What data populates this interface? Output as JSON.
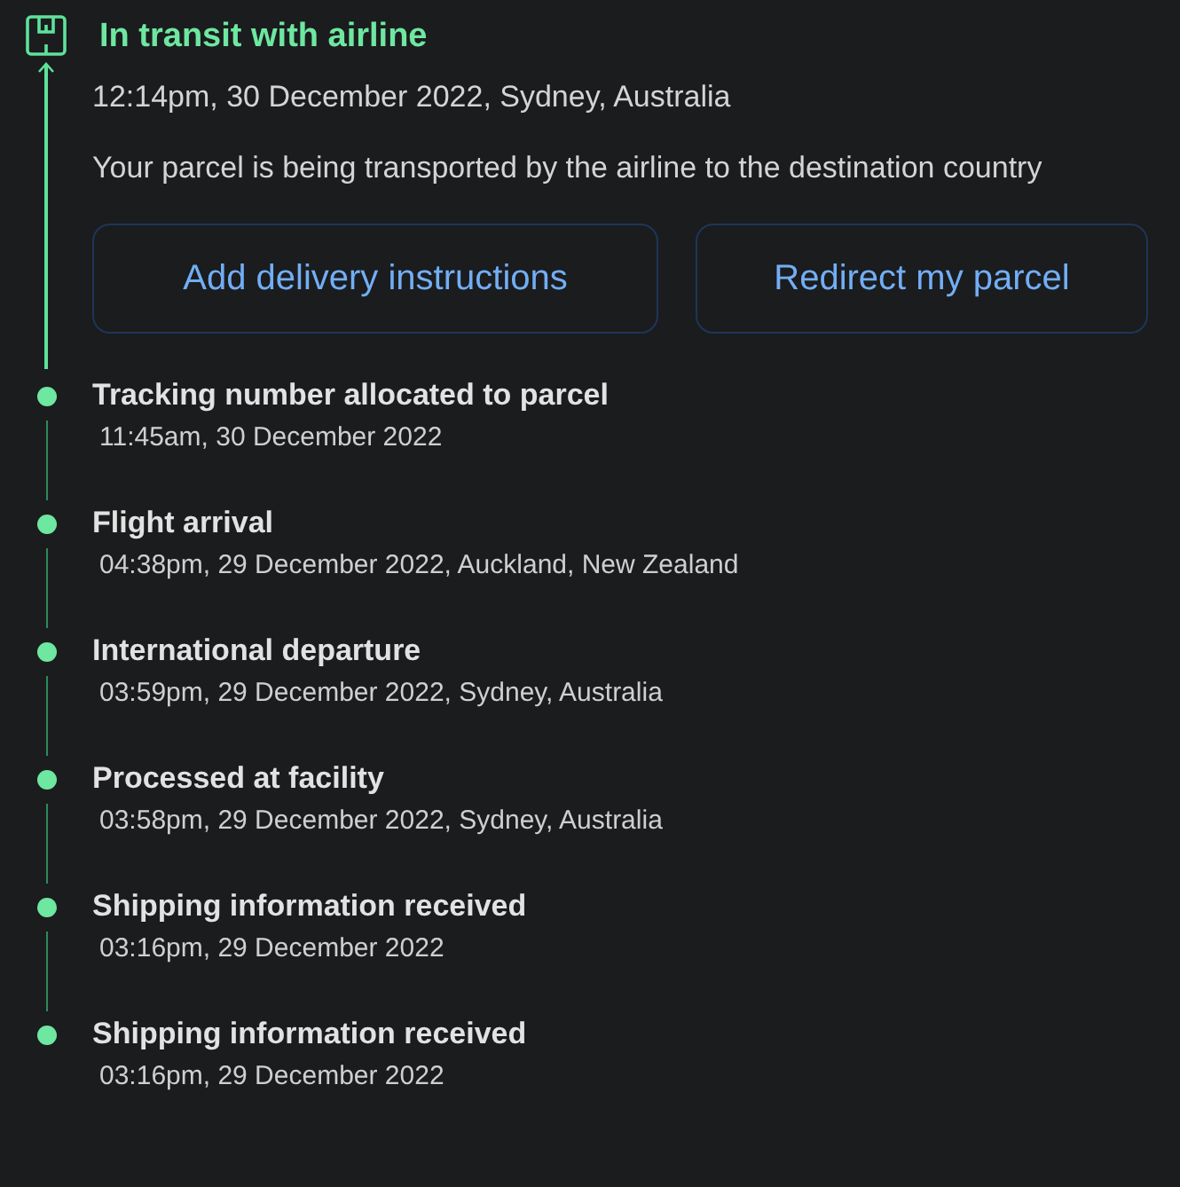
{
  "current": {
    "title": "In transit with airline",
    "date": "12:14pm, 30 December 2022, Sydney, Australia",
    "description": "Your parcel is being transported by the airline to the destination country",
    "buttons": [
      "Add delivery instructions",
      "Redirect my parcel"
    ]
  },
  "events": [
    {
      "title": "Tracking number allocated to parcel",
      "date": "11:45am, 30 December 2022"
    },
    {
      "title": "Flight arrival",
      "date": "04:38pm, 29 December 2022, Auckland, New Zealand"
    },
    {
      "title": "International departure",
      "date": "03:59pm, 29 December 2022, Sydney, Australia"
    },
    {
      "title": "Processed at facility",
      "date": "03:58pm, 29 December 2022, Sydney, Australia"
    },
    {
      "title": "Shipping information received",
      "date": "03:16pm, 29 December 2022"
    },
    {
      "title": "Shipping information received",
      "date": "03:16pm, 29 December 2022"
    }
  ]
}
